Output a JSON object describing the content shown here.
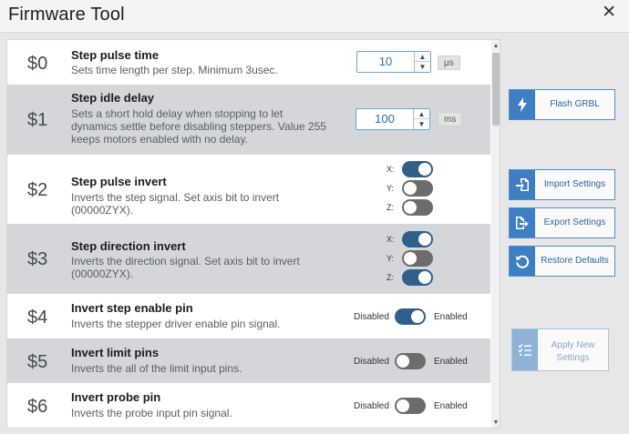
{
  "window": {
    "title": "Firmware Tool",
    "close_glyph": "✕"
  },
  "settings": [
    {
      "num": "$0",
      "name": "Step pulse time",
      "desc": "Sets time length per step. Minimum 3usec.",
      "control": "number",
      "value": "10",
      "unit": "μs"
    },
    {
      "num": "$1",
      "name": "Step idle delay",
      "desc": "Sets a short hold delay when stopping to let dynamics settle before disabling steppers. Value 255 keeps motors enabled with no delay.",
      "control": "number",
      "value": "100",
      "unit": "ms"
    },
    {
      "num": "$2",
      "name": "Step pulse invert",
      "desc": "Inverts the step signal. Set axis bit to invert (00000ZYX).",
      "control": "axes",
      "axes": [
        {
          "label": "X:",
          "on": true
        },
        {
          "label": "Y:",
          "on": false
        },
        {
          "label": "Z:",
          "on": false
        }
      ]
    },
    {
      "num": "$3",
      "name": "Step direction invert",
      "desc": "Inverts the direction signal. Set axis bit to invert (00000ZYX).",
      "control": "axes",
      "axes": [
        {
          "label": "X:",
          "on": true
        },
        {
          "label": "Y:",
          "on": false
        },
        {
          "label": "Z:",
          "on": true
        }
      ]
    },
    {
      "num": "$4",
      "name": "Invert step enable pin",
      "desc": "Inverts the stepper driver enable pin signal.",
      "control": "toggle",
      "on": true,
      "off_label": "Disabled",
      "on_label": "Enabled"
    },
    {
      "num": "$5",
      "name": "Invert limit pins",
      "desc": "Inverts the all of the limit input pins.",
      "control": "toggle",
      "on": false,
      "off_label": "Disabled",
      "on_label": "Enabled"
    },
    {
      "num": "$6",
      "name": "Invert probe pin",
      "desc": "Inverts the probe input pin signal.",
      "control": "toggle",
      "on": false,
      "off_label": "Disabled",
      "on_label": "Enabled"
    }
  ],
  "sidebar": {
    "flash": {
      "label": "Flash GRBL",
      "icon": "lightning-icon"
    },
    "import": {
      "label": "Import Settings",
      "icon": "file-import-icon"
    },
    "export": {
      "label": "Export Settings",
      "icon": "file-export-icon"
    },
    "restore": {
      "label": "Restore Defaults",
      "icon": "undo-icon"
    },
    "apply": {
      "label": "Apply New Settings",
      "icon": "checklist-icon",
      "enabled": false
    }
  },
  "colors": {
    "accent": "#3d7fc2",
    "toggle_on": "#2f5f8a",
    "toggle_off": "#6c6c6c",
    "row_alt": "#d4d6da"
  }
}
